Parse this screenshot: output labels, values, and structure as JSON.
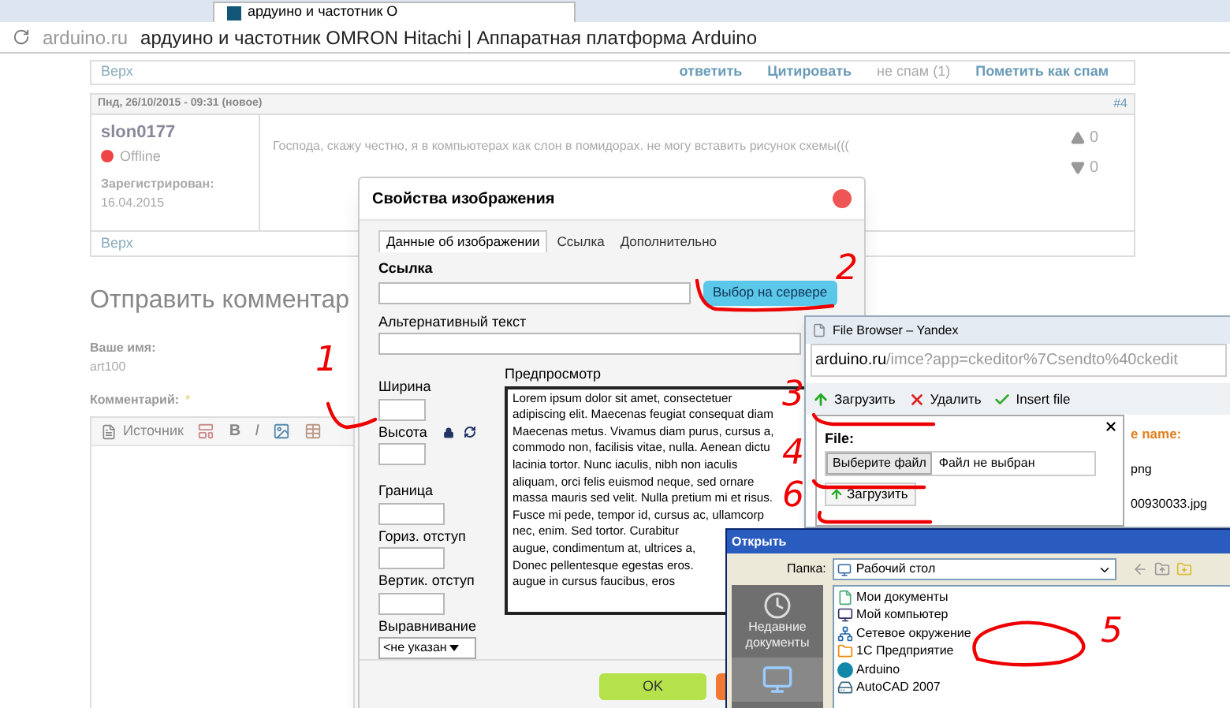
{
  "browser": {
    "tab_title": "ардуино и частотник О",
    "address_domain": "arduino.ru",
    "address_title": "ардуино и частотник OMRON Hitachi | Аппаратная платформа Arduino"
  },
  "prev_post_footer": {
    "top_link": "Верх",
    "actions": [
      {
        "kind": "link",
        "label": "ответить"
      },
      {
        "kind": "link",
        "label": "Цитировать"
      },
      {
        "kind": "plain",
        "label": "не спам (1)"
      },
      {
        "kind": "link",
        "label": "Пометить как спам"
      }
    ]
  },
  "post": {
    "date": "Пнд, 26/10/2015 - 09:31 (новое)",
    "number": "#4",
    "author": "slon0177",
    "status": "Offline",
    "registered_label": "Зарегистрирован:",
    "registered_date": "16.04.2015",
    "text": "Господа, скажу честно, я в компьютерах как слон в помидорах. не могу вставить рисунок схемы(((",
    "votes": [
      {
        "kind": "up",
        "count": "0"
      },
      {
        "kind": "down",
        "count": "0"
      }
    ],
    "top_link": "Верх"
  },
  "comment_form": {
    "heading": "Отправить комментар",
    "name_label": "Ваше имя:",
    "name_value": "art100",
    "comment_label": "Комментарий:",
    "required_mark": "*",
    "toolbar": [
      {
        "kind": "source",
        "label": "Источник"
      },
      {
        "kind": "templates"
      },
      {
        "kind": "bold",
        "label": "B"
      },
      {
        "kind": "italic",
        "label": "I"
      },
      {
        "kind": "image"
      },
      {
        "kind": "table"
      }
    ]
  },
  "image_dialog": {
    "title": "Свойства изображения",
    "tabs": [
      {
        "label": "Данные об изображении",
        "selected": true
      },
      {
        "label": "Ссылка",
        "selected": false
      },
      {
        "label": "Дополнительно",
        "selected": false
      }
    ],
    "url_label": "Ссылка",
    "server_button": "Выбор на сервере",
    "alt_label": "Альтернативный текст",
    "width_label": "Ширина",
    "height_label": "Высота",
    "border_label": "Граница",
    "hspace_label": "Гориз. отступ",
    "vspace_label": "Вертик. отступ",
    "align_label": "Выравнивание",
    "align_value": "<не указан",
    "preview_label": "Предпросмотр",
    "preview_lines": [
      "Lorem ipsum dolor sit amet, consectetuer",
      "adipiscing elit. Maecenas feugiat consequat diam",
      "Maecenas metus. Vivamus diam purus, cursus a,",
      "commodo non, facilisis vitae, nulla. Aenean dictu",
      "lacinia tortor. Nunc iaculis, nibh non iaculis",
      "aliquam, orci felis euismod neque, sed ornare",
      "massa mauris sed velit. Nulla pretium mi et risus.",
      "Fusce mi pede, tempor id, cursus ac, ullamcorp",
      "nec, enim. Sed tortor. Curabitur",
      "augue, condimentum at, ultrices a,",
      "Donec pellentesque egestas eros.",
      "augue in cursus faucibus, eros"
    ],
    "ok_button": "OK"
  },
  "file_browser": {
    "title": "File Browser – Yandex",
    "url_domain": "arduino.ru",
    "url_path": "/imce?app=ckeditor%7Csendto%40ckedit",
    "toolbar": [
      {
        "kind": "upload",
        "label": "Загрузить"
      },
      {
        "kind": "delete",
        "label": "Удалить"
      },
      {
        "kind": "insert",
        "label": "Insert file"
      }
    ],
    "file_label": "File:",
    "choose_button": "Выберите файл",
    "no_file": "Файл не выбран",
    "upload_button": "Загрузить",
    "column_header": "e name:",
    "files": [
      "png",
      "00930033.jpg"
    ]
  },
  "open_dialog": {
    "title": "Открыть",
    "folder_label": "Папка:",
    "folder_value": "Рабочий стол",
    "places": [
      {
        "kind": "recent",
        "label": "Недавние документы"
      },
      {
        "kind": "desktop"
      }
    ],
    "items": [
      {
        "kind": "documents",
        "label": "Мои документы"
      },
      {
        "kind": "computer",
        "label": "Мой компьютер"
      },
      {
        "kind": "network",
        "label": "Сетевое окружение"
      },
      {
        "kind": "app",
        "label": "1С Предприятие"
      },
      {
        "kind": "arduino",
        "label": "Arduino"
      },
      {
        "kind": "autocad",
        "label": "AutoCAD 2007"
      }
    ]
  },
  "annotations": [
    {
      "label": "1"
    },
    {
      "label": "2"
    },
    {
      "label": "3"
    },
    {
      "label": "4"
    },
    {
      "label": "6"
    },
    {
      "label": "5"
    }
  ]
}
